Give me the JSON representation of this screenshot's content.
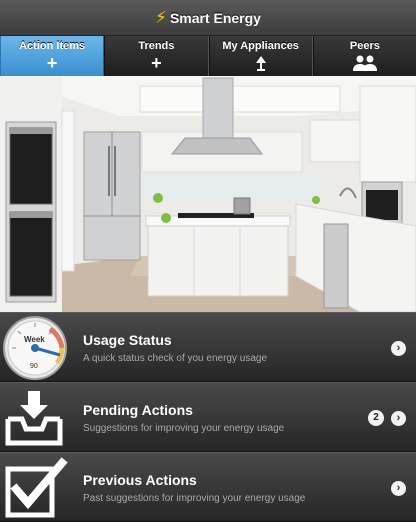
{
  "header": {
    "title": "Smart Energy",
    "logo_icon": "lightning-bolt-icon",
    "accent": "#f5c800"
  },
  "tabs": [
    {
      "label": "Action Items",
      "icon": "plus-icon",
      "active": true
    },
    {
      "label": "Trends",
      "icon": "plus-icon",
      "active": false
    },
    {
      "label": "My Appliances",
      "icon": "lamp-icon",
      "active": false
    },
    {
      "label": "Peers",
      "icon": "people-icon",
      "active": false
    }
  ],
  "active_tab_color": "#4ba3df",
  "hero": {
    "image": "kitchen-photo"
  },
  "items": [
    {
      "title": "Usage Status",
      "subtitle": "A quick status check of you energy usage",
      "icon": "gauge-icon",
      "gauge": {
        "label": "Week",
        "value": "90"
      }
    },
    {
      "title": "Pending Actions",
      "subtitle": "Suggestions for improving your energy usage",
      "icon": "inbox-download-icon",
      "count": "2"
    },
    {
      "title": "Previous Actions",
      "subtitle": "Past suggestions for improving your energy usage",
      "icon": "checkbox-checked-icon"
    }
  ]
}
